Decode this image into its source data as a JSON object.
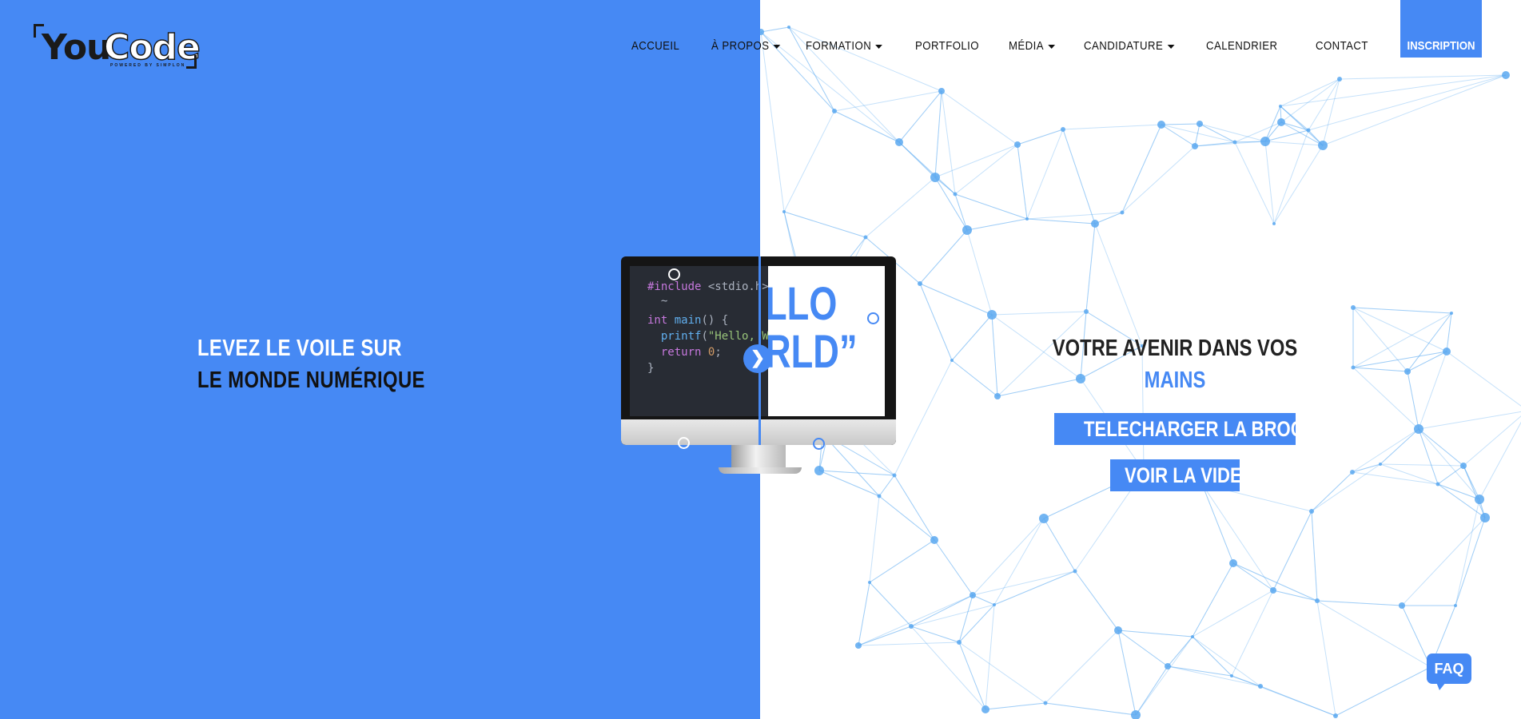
{
  "brand": {
    "logo_you": "You",
    "logo_code": "Code",
    "logo_powered": "POWERED BY SIMPLON"
  },
  "nav": {
    "items": [
      {
        "label": "ACCUEIL",
        "dropdown": false
      },
      {
        "label": "À PROPOS",
        "dropdown": true
      },
      {
        "label": "FORMATION",
        "dropdown": true
      },
      {
        "label": "PORTFOLIO",
        "dropdown": false
      },
      {
        "label": "MÉDIA",
        "dropdown": true
      },
      {
        "label": "CANDIDATURE",
        "dropdown": true
      },
      {
        "label": "CALENDRIER",
        "dropdown": false
      },
      {
        "label": "CONTACT",
        "dropdown": false
      }
    ],
    "cta": "INSCRIPTION"
  },
  "hero_left": {
    "line1": "LEVEZ LE VOILE SUR",
    "line2": "LE MONDE NUMÉRIQUE"
  },
  "hero_right": {
    "line1": "VOTRE AVENIR DANS VOS",
    "line2": "MAINS",
    "brochure_button": "TELECHARGER LA BROCHURE",
    "video_button": "VOIR LA VIDEO"
  },
  "monitor": {
    "code_lines": [
      {
        "parts": [
          [
            "kw",
            "#include "
          ],
          [
            "",
            "<stdio.h>"
          ]
        ]
      },
      {
        "parts": [
          [
            "",
            "  ~"
          ]
        ]
      },
      {
        "parts": [
          [
            "kw",
            "int "
          ],
          [
            "fn",
            "main"
          ],
          [
            "",
            "() {"
          ]
        ]
      },
      {
        "parts": [
          [
            "",
            "  "
          ],
          [
            "fn",
            "printf"
          ],
          [
            "",
            "("
          ],
          [
            "str",
            "\"Hello, World\""
          ],
          [
            "",
            ");"
          ]
        ]
      },
      {
        "parts": [
          [
            "",
            "  "
          ],
          [
            "kw",
            "return "
          ],
          [
            "num",
            "0"
          ],
          [
            "",
            ";"
          ]
        ]
      },
      {
        "parts": [
          [
            "",
            "}"
          ]
        ]
      }
    ],
    "hello_text": "LLO\nRLD”",
    "handle_icon": "chevron-right-icon"
  },
  "faq": {
    "label": "FAQ"
  },
  "colors": {
    "accent": "#4689f4",
    "dark": "#111111",
    "network": "#5aa8f0"
  }
}
